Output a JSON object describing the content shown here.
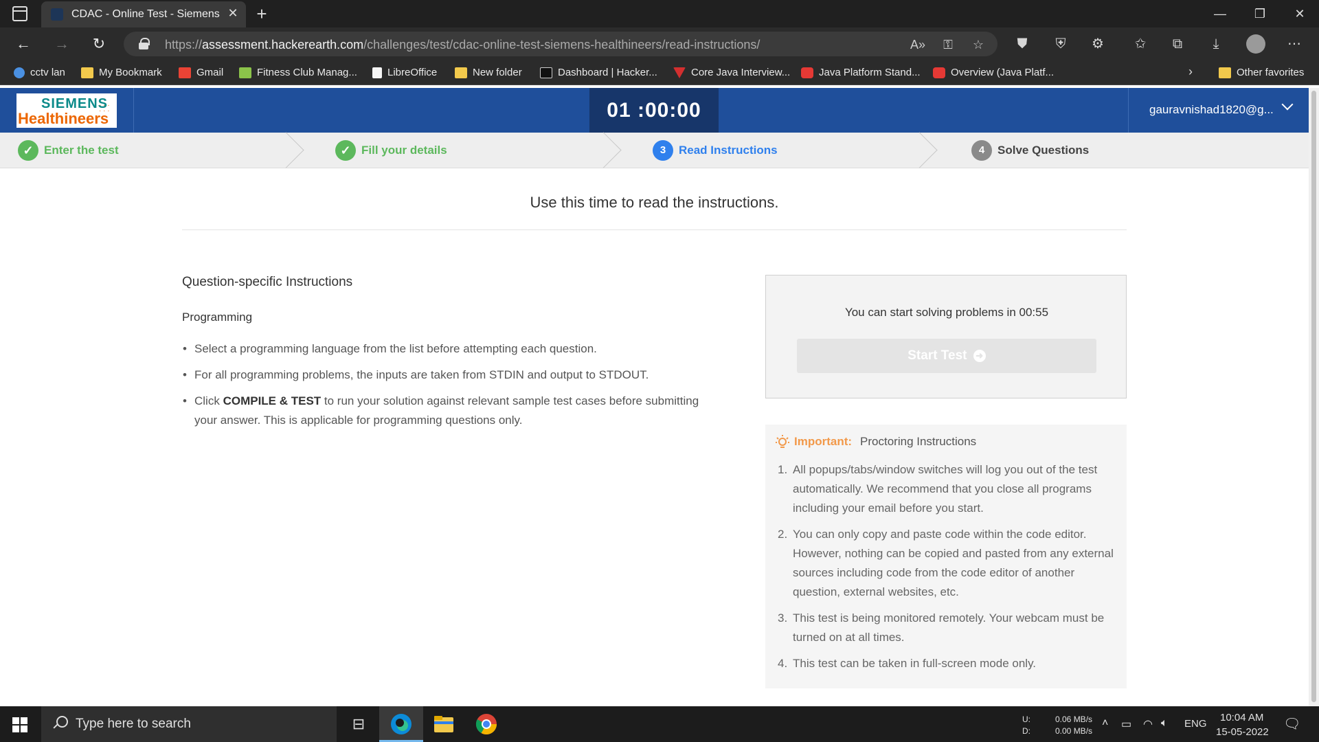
{
  "browser": {
    "tab_title": "CDAC - Online Test - Siemens He",
    "url_prefix": "https://",
    "url_host": "assessment.hackerearth.com",
    "url_path": "/challenges/test/cdac-online-test-siemens-healthineers/read-instructions/",
    "bookmarks": [
      {
        "label": "cctv lan",
        "icon": "edge-bookmark-icon"
      },
      {
        "label": "My Bookmark",
        "icon": "folder-icon"
      },
      {
        "label": "Gmail",
        "icon": "gmail-icon"
      },
      {
        "label": "Fitness Club Manag...",
        "icon": "fitness-icon"
      },
      {
        "label": "LibreOffice",
        "icon": "document-icon"
      },
      {
        "label": "New folder",
        "icon": "folder-icon"
      },
      {
        "label": "Dashboard | Hacker...",
        "icon": "hackerearth-icon"
      },
      {
        "label": "Core Java Interview...",
        "icon": "core-java-icon"
      },
      {
        "label": "Java Platform Stand...",
        "icon": "oracle-icon"
      },
      {
        "label": "Overview (Java Platf...",
        "icon": "oracle-icon"
      }
    ],
    "other_favorites": "Other favorites"
  },
  "header": {
    "logo_top": "SIEMENS",
    "logo_bottom": "Healthineers",
    "timer": "01 :00:00",
    "user": "gauravnishad1820@g..."
  },
  "steps": [
    {
      "label": "Enter the test",
      "state": "done",
      "marker": "✓"
    },
    {
      "label": "Fill your details",
      "state": "done",
      "marker": "✓"
    },
    {
      "label": "Read Instructions",
      "state": "active",
      "marker": "3"
    },
    {
      "label": "Solve Questions",
      "state": "pending",
      "marker": "4"
    }
  ],
  "intro": "Use this time to read the instructions.",
  "instructions": {
    "title": "Question-specific Instructions",
    "subtitle": "Programming",
    "bullet1": "Select a programming language from the list before attempting each question.",
    "bullet2": "For all programming problems, the inputs are taken from STDIN and output to STDOUT.",
    "bullet3_prefix": "Click ",
    "bullet3_bold": "COMPILE & TEST",
    "bullet3_suffix": " to run your solution against relevant sample test cases before submitting your answer. This is applicable for programming questions only."
  },
  "start": {
    "message": "You can start solving problems in 00:55",
    "button": "Start Test",
    "button_icon": "arrow-right-circle-icon"
  },
  "proctoring": {
    "important": "Important:",
    "title": "Proctoring Instructions",
    "items": [
      {
        "num": "1.",
        "text": "All popups/tabs/window switches will log you out of the test automatically. We recommend that you close all programs including your email before you start."
      },
      {
        "num": "2.",
        "text": "You can only copy and paste code within the code editor. However, nothing can be copied and pasted from any external sources including code from the code editor of another question, external websites, etc."
      },
      {
        "num": "3.",
        "text": "This test is being monitored remotely. Your webcam must be turned on at all times."
      },
      {
        "num": "4.",
        "text": "This test can be taken in full-screen mode only."
      }
    ]
  },
  "taskbar": {
    "search_placeholder": "Type here to search",
    "net_up_label": "U:",
    "net_down_label": "D:",
    "net_up": "0.06 MB/s",
    "net_down": "0.00 MB/s",
    "lang": "ENG",
    "time": "10:04 AM",
    "date": "15-05-2022"
  },
  "colors": {
    "header_blue": "#1f4f9b",
    "timer_bg": "#17366a",
    "done_green": "#5cb85c",
    "active_blue": "#2f80ed",
    "important_orange": "#f2994a"
  }
}
